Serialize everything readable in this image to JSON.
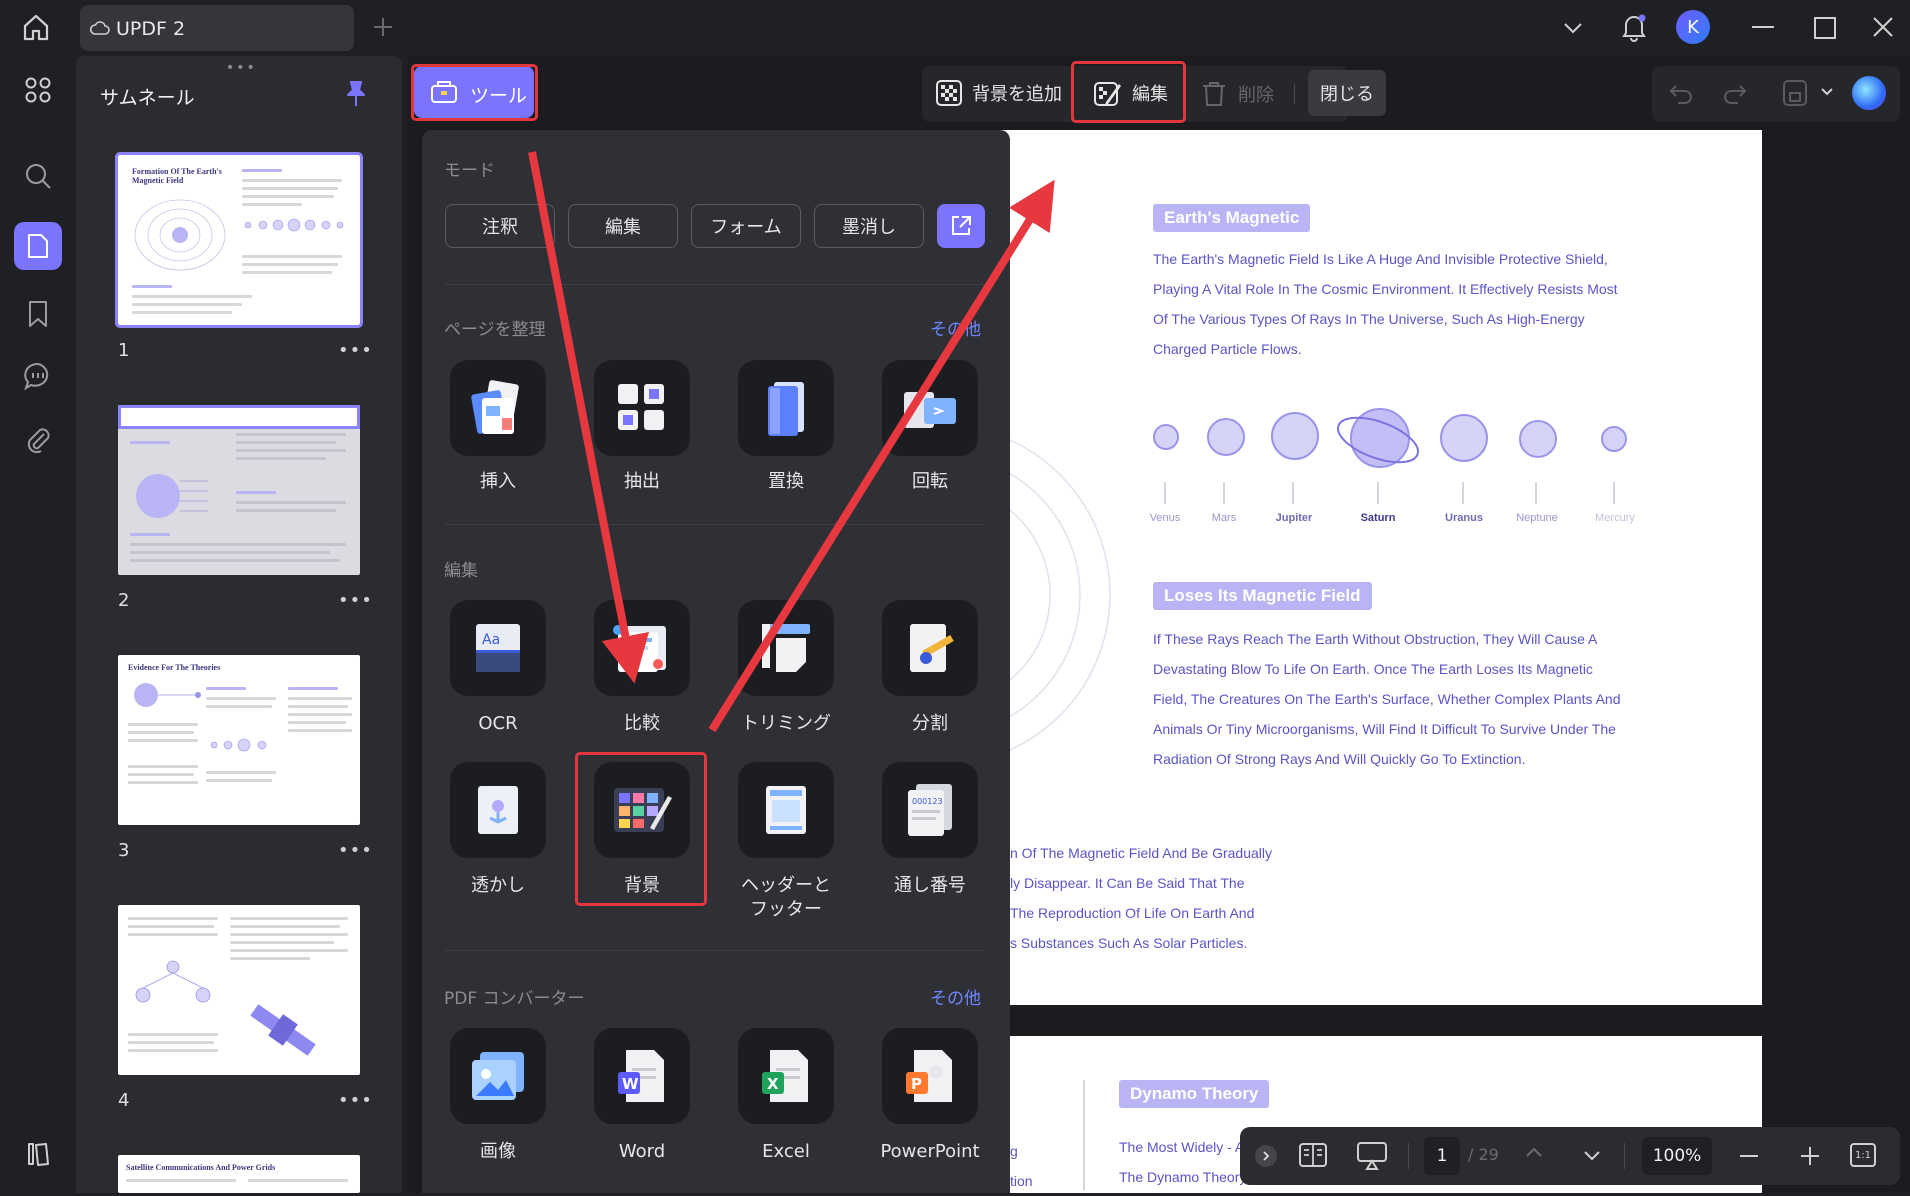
{
  "titlebar": {
    "tab_title": "UPDF 2",
    "avatar_letter": "K"
  },
  "thumbnails": {
    "title": "サムネール",
    "pages": [
      {
        "num": "1",
        "heading": "Formation Of The Earth's Magnetic Field"
      },
      {
        "num": "2"
      },
      {
        "num": "3",
        "heading": "Evidence For The Theories"
      },
      {
        "num": "4"
      },
      {
        "heading": "Satellite Communications And Power Grids"
      }
    ],
    "more_label": "•••"
  },
  "toolbar": {
    "tools_label": "ツール",
    "add_background_label": "背景を追加",
    "edit_label": "編集",
    "delete_label": "削除",
    "close_label": "閉じる"
  },
  "tools_panel": {
    "mode_section": "モード",
    "modes": [
      "注釈",
      "編集",
      "フォーム",
      "墨消し"
    ],
    "organize_section": "ページを整理",
    "organize_more": "その他",
    "organize_tools": [
      "挿入",
      "抽出",
      "置換",
      "回転"
    ],
    "edit_section": "編集",
    "edit_tools_row1": [
      "OCR",
      "比較",
      "トリミング",
      "分割"
    ],
    "edit_tools_row2": [
      "透かし",
      "背景",
      "ヘッダーと\nフッター",
      "通し番号"
    ],
    "converter_section": "PDF コンバーター",
    "converter_more": "その他",
    "converter_tools": [
      "画像",
      "Word",
      "Excel",
      "PowerPoint"
    ]
  },
  "document": {
    "heading1": "Earth's Magnetic",
    "para1": [
      "The Earth's Magnetic Field Is Like A Huge And Invisible Protective Shield,",
      "Playing A Vital Role In The Cosmic Environment. It Effectively Resists Most",
      "Of The Various Types Of Rays In The Universe, Such As High-Energy",
      "Charged Particle Flows."
    ],
    "planets": [
      "Venus",
      "Mars",
      "Jupiter",
      "Saturn",
      "Uranus",
      "Neptune",
      "Mercury"
    ],
    "heading2": "Loses Its Magnetic Field",
    "para2": [
      "If These Rays Reach The Earth Without Obstruction, They Will Cause A",
      "Devastating Blow To Life On Earth. Once The Earth Loses Its Magnetic",
      "Field, The Creatures On The Earth's Surface, Whether Complex Plants And",
      "Animals Or Tiny Microorganisms, Will Find It Difficult To Survive Under The",
      "Radiation Of Strong Rays And Will Quickly Go To Extinction."
    ],
    "para3": [
      "n Of The Magnetic Field And Be Gradually",
      "ly Disappear. It Can Be Said That The",
      " The Reproduction Of Life On Earth And",
      "s Substances Such As Solar Particles."
    ],
    "heading3": "Dynamo Theory",
    "page2_line1": "The Most Widely - A",
    "page2_line2": "The Dynamo Theory",
    "page2_frag1": "g",
    "page2_frag2": "tion"
  },
  "bottombar": {
    "page_current": "1",
    "page_total": "/ 29",
    "zoom": "100%",
    "fit_label": "1:1"
  },
  "colors": {
    "accent": "#7b74ff",
    "highlight_red": "#e2373c",
    "annotation_arrow": "#e8383f"
  }
}
